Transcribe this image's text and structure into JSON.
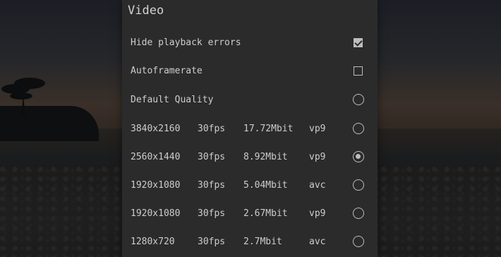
{
  "panel": {
    "title": "Video",
    "options": [
      {
        "label": "Hide playback errors",
        "control": "checkbox",
        "checked": true
      },
      {
        "label": "Autoframerate",
        "control": "checkbox",
        "checked": false
      },
      {
        "label": "Default Quality",
        "control": "radio",
        "checked": false
      }
    ],
    "formats": [
      {
        "resolution": "3840x2160",
        "fps": "30fps",
        "bitrate": "17.72Mbit",
        "codec": "vp9",
        "selected": false
      },
      {
        "resolution": "2560x1440",
        "fps": "30fps",
        "bitrate": "8.92Mbit",
        "codec": "vp9",
        "selected": true
      },
      {
        "resolution": "1920x1080",
        "fps": "30fps",
        "bitrate": "5.04Mbit",
        "codec": "avc",
        "selected": false
      },
      {
        "resolution": "1920x1080",
        "fps": "30fps",
        "bitrate": "2.67Mbit",
        "codec": "vp9",
        "selected": false
      },
      {
        "resolution": "1280x720",
        "fps": "30fps",
        "bitrate": "2.7Mbit",
        "codec": "avc",
        "selected": false
      }
    ]
  },
  "colors": {
    "panel_bg": "#2b2b2b",
    "text": "#cdcdcd",
    "control": "#bdbdbd"
  }
}
